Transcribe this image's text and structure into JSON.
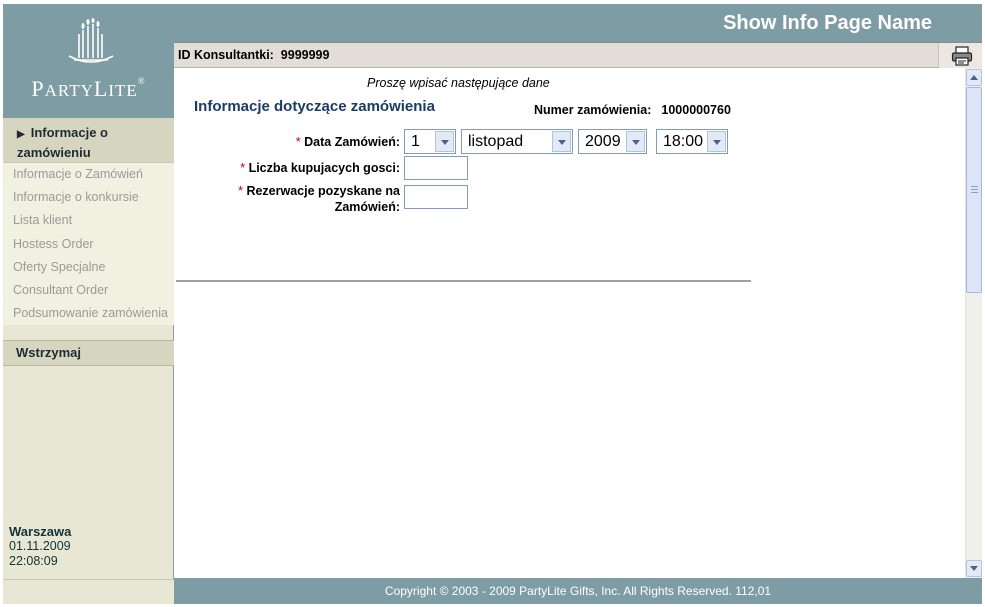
{
  "header": {
    "page_name": "Show Info Page Name"
  },
  "brand": {
    "logo_text_first": "P",
    "logo_text_rest": "ARTY",
    "logo_text_second": "L",
    "logo_text_rest2": "ITE",
    "logo_mark": "®"
  },
  "id_bar": {
    "label": "ID Konsultantki:",
    "value": "9999999",
    "print_icon": "printer-icon"
  },
  "sidebar": {
    "current": "Informacje o zamówieniu",
    "items": [
      {
        "label": "Informacje o Zamówień"
      },
      {
        "label": "Informacje o konkursie"
      },
      {
        "label": "Lista klient"
      },
      {
        "label": "Hostess Order"
      },
      {
        "label": "Oferty Specjalne"
      },
      {
        "label": "Consultant Order"
      },
      {
        "label": "Podsumowanie zamówienia"
      }
    ],
    "hold": "Wstrzymaj",
    "location": {
      "city": "Warszawa",
      "date": "01.11.2009",
      "time": "22:08:09"
    }
  },
  "form": {
    "prompt": "Proszę wpisać następujące dane",
    "title": "Informacje dotyczące zamówienia",
    "order_number_label": "Numer zamówienia:",
    "order_number_value": "1000000760",
    "date_label": "Data Zamówień:",
    "guests_label": "Liczba kupujacych gosci:",
    "reservations_label": "Rezerwacje pozyskane na Zamówień:",
    "required_mark": "*",
    "date": {
      "day": "1",
      "month": "listopad",
      "year": "2009",
      "time": "18:00"
    },
    "guests_value": "",
    "reservations_value": ""
  },
  "footer": {
    "copyright": "Copyright © 2003 - 2009 PartyLite Gifts, Inc. All Rights Reserved.  112,01"
  },
  "colors": {
    "header_bg": "#7e9ca3",
    "sidebar_bg": "#e7e7d4",
    "title": "#1c3c66",
    "required": "#c00000"
  }
}
